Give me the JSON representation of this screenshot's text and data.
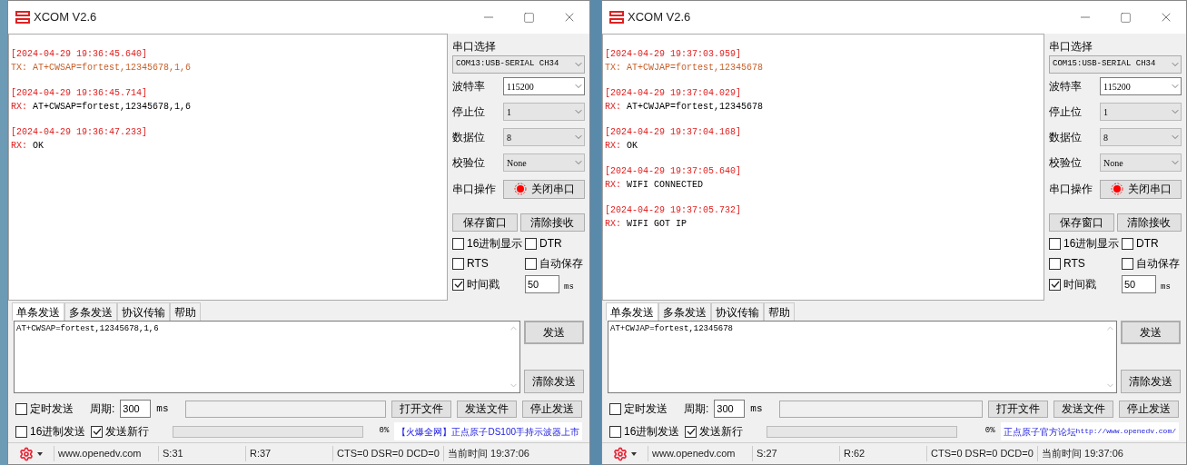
{
  "windows": [
    {
      "title": "XCOM V2.6",
      "log": [
        {
          "time": "[2024-04-29 19:36:45.640]",
          "kind": "tx",
          "prefix": "TX:",
          "text": "AT+CWSAP=fortest,12345678,1,6"
        },
        {
          "time": "[2024-04-29 19:36:45.714]",
          "kind": "rx",
          "prefix": "RX:",
          "text": "AT+CWSAP=fortest,12345678,1,6"
        },
        {
          "time": "[2024-04-29 19:36:47.233]",
          "kind": "rx",
          "prefix": "RX:",
          "text": "OK"
        }
      ],
      "port_label": "串口选择",
      "port": "COM13:USB-SERIAL CH34",
      "fields": [
        {
          "label": "波特率",
          "value": "115200",
          "kind": "combo"
        },
        {
          "label": "停止位",
          "value": "1",
          "kind": "select"
        },
        {
          "label": "数据位",
          "value": "8",
          "kind": "select"
        },
        {
          "label": "校验位",
          "value": "None",
          "kind": "select"
        }
      ],
      "operation": {
        "label": "串口操作",
        "button": "关闭串口",
        "open": true
      },
      "save_button": "保存窗口",
      "clear_button": "清除接收",
      "options": [
        {
          "label": "16进制显示",
          "checked": false
        },
        {
          "label": "DTR",
          "checked": false
        },
        {
          "label": "RTS",
          "checked": false
        },
        {
          "label": "自动保存",
          "checked": false
        },
        {
          "label": "时间戳",
          "checked": true
        }
      ],
      "interval": "50",
      "interval_unit": "ms",
      "tabs": [
        {
          "label": "单条发送",
          "selected": true
        },
        {
          "label": "多条发送",
          "selected": false
        },
        {
          "label": "协议传输",
          "selected": false
        },
        {
          "label": "帮助",
          "selected": false
        }
      ],
      "send_text": "AT+CWSAP=fortest,12345678,1,6",
      "send_button": "发送",
      "clear_send_button": "清除发送",
      "timed_send": {
        "label": "定时发送",
        "checked": false
      },
      "period_label": "周期:",
      "period": "300",
      "period_unit": "ms",
      "open_file_button": "打开文件",
      "send_file_button": "发送文件",
      "stop_send_button": "停止发送",
      "hex_send": {
        "label": "16进制发送",
        "checked": false
      },
      "newline": {
        "label": "发送新行",
        "checked": true
      },
      "progress": {
        "level": 0,
        "reading": "0%"
      },
      "ad": [
        {
          "text": "【火爆全网】正点原子DS100手持示波器上市",
          "kind": "text"
        }
      ],
      "status": {
        "url": "www.openedv.com",
        "sent": "S:31",
        "received": "R:37",
        "lines": "CTS=0 DSR=0 DCD=0",
        "time": "当前时间 19:37:06"
      }
    },
    {
      "title": "XCOM V2.6",
      "log": [
        {
          "time": "[2024-04-29 19:37:03.959]",
          "kind": "tx",
          "prefix": "TX:",
          "text": "AT+CWJAP=fortest,12345678"
        },
        {
          "time": "[2024-04-29 19:37:04.029]",
          "kind": "rx",
          "prefix": "RX:",
          "text": "AT+CWJAP=fortest,12345678"
        },
        {
          "time": "[2024-04-29 19:37:04.168]",
          "kind": "rx",
          "prefix": "RX:",
          "text": "OK"
        },
        {
          "time": "[2024-04-29 19:37:05.640]",
          "kind": "rx",
          "prefix": "RX:",
          "text": "WIFI CONNECTED"
        },
        {
          "time": "[2024-04-29 19:37:05.732]",
          "kind": "rx",
          "prefix": "RX:",
          "text": "WIFI GOT IP"
        }
      ],
      "port_label": "串口选择",
      "port": "COM15:USB-SERIAL CH34",
      "fields": [
        {
          "label": "波特率",
          "value": "115200",
          "kind": "combo"
        },
        {
          "label": "停止位",
          "value": "1",
          "kind": "select"
        },
        {
          "label": "数据位",
          "value": "8",
          "kind": "select"
        },
        {
          "label": "校验位",
          "value": "None",
          "kind": "select"
        }
      ],
      "operation": {
        "label": "串口操作",
        "button": "关闭串口",
        "open": true
      },
      "save_button": "保存窗口",
      "clear_button": "清除接收",
      "options": [
        {
          "label": "16进制显示",
          "checked": false
        },
        {
          "label": "DTR",
          "checked": false
        },
        {
          "label": "RTS",
          "checked": false
        },
        {
          "label": "自动保存",
          "checked": false
        },
        {
          "label": "时间戳",
          "checked": true
        }
      ],
      "interval": "50",
      "interval_unit": "ms",
      "tabs": [
        {
          "label": "单条发送",
          "selected": true
        },
        {
          "label": "多条发送",
          "selected": false
        },
        {
          "label": "协议传输",
          "selected": false
        },
        {
          "label": "帮助",
          "selected": false
        }
      ],
      "send_text": "AT+CWJAP=fortest,12345678",
      "send_button": "发送",
      "clear_send_button": "清除发送",
      "timed_send": {
        "label": "定时发送",
        "checked": false
      },
      "period_label": "周期:",
      "period": "300",
      "period_unit": "ms",
      "open_file_button": "打开文件",
      "send_file_button": "发送文件",
      "stop_send_button": "停止发送",
      "hex_send": {
        "label": "16进制发送",
        "checked": false
      },
      "newline": {
        "label": "发送新行",
        "checked": true
      },
      "progress": {
        "level": 0,
        "reading": "0%"
      },
      "ad": [
        {
          "text": "正点原子官方论坛",
          "kind": "text"
        },
        {
          "text": "http://www.openedv.com/",
          "kind": "mono"
        }
      ],
      "status": {
        "url": "www.openedv.com",
        "sent": "S:27",
        "received": "R:62",
        "lines": "CTS=0 DSR=0 DCD=0",
        "time": "当前时间 19:37:06"
      }
    }
  ]
}
